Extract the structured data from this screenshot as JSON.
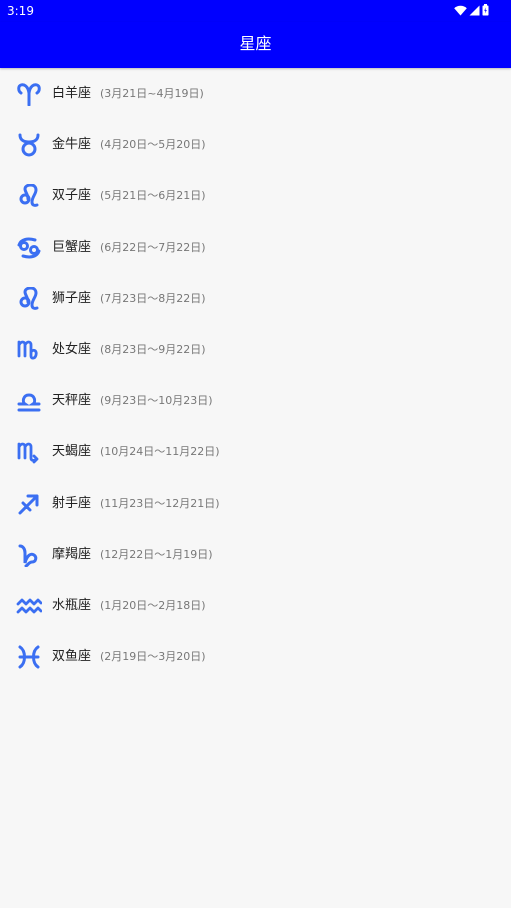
{
  "status_bar": {
    "time": "3:19",
    "icons": [
      "wifi-icon",
      "cell-signal-icon",
      "battery-icon"
    ]
  },
  "app_bar": {
    "title": "星座",
    "background": "#0000ff"
  },
  "accent_color": "#3b6ff2",
  "signs": [
    {
      "name": "白羊座",
      "dates": "(3月21日~4月19日)",
      "icon": "aries-icon"
    },
    {
      "name": "金牛座",
      "dates": "(4月20日～5月20日)",
      "icon": "taurus-icon"
    },
    {
      "name": "双子座",
      "dates": "(5月21日～6月21日)",
      "icon": "gemini-icon"
    },
    {
      "name": "巨蟹座",
      "dates": "(6月22日～7月22日)",
      "icon": "cancer-icon"
    },
    {
      "name": "狮子座",
      "dates": "(7月23日～8月22日)",
      "icon": "leo-icon"
    },
    {
      "name": "处女座",
      "dates": "(8月23日～9月22日)",
      "icon": "virgo-icon"
    },
    {
      "name": "天秤座",
      "dates": "(9月23日～10月23日)",
      "icon": "libra-icon"
    },
    {
      "name": "天蝎座",
      "dates": "(10月24日～11月22日)",
      "icon": "scorpio-icon"
    },
    {
      "name": "射手座",
      "dates": "(11月23日～12月21日)",
      "icon": "sagittarius-icon"
    },
    {
      "name": "摩羯座",
      "dates": "(12月22日～1月19日)",
      "icon": "capricorn-icon"
    },
    {
      "name": "水瓶座",
      "dates": "(1月20日～2月18日)",
      "icon": "aquarius-icon"
    },
    {
      "name": "双鱼座",
      "dates": "(2月19日～3月20日)",
      "icon": "pisces-icon"
    }
  ]
}
